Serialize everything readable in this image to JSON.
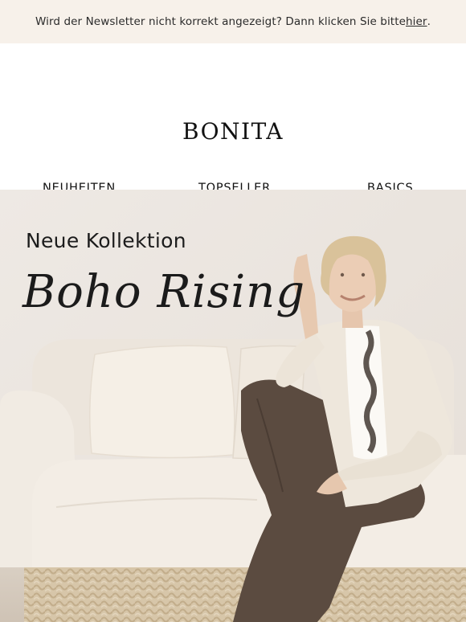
{
  "newsletter": {
    "prefix": "Wird der Newsletter nicht korrekt angezeigt? Dann klicken Sie bitte ",
    "link": "hier",
    "suffix": "."
  },
  "brand": {
    "logo": "BONITA"
  },
  "nav": [
    "NEUHEITEN",
    "TOPSELLER",
    "BASICS"
  ],
  "hero": {
    "kicker": "Neue Kollektion",
    "script_title": "Boho Rising"
  },
  "colors": {
    "topbar_bg": "#f7f1ea",
    "wall": "#ede7e1",
    "sofa": "#efe9e1",
    "trousers": "#5a4a3f"
  }
}
